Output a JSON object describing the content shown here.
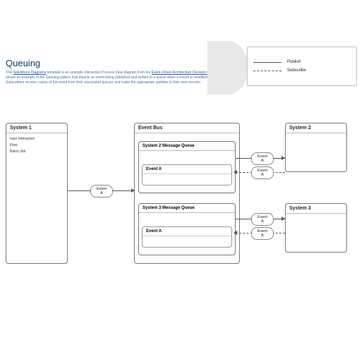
{
  "header": {
    "title": "Queuing",
    "desc_pre": "This ",
    "link1": "Salesforce Diagrams",
    "desc_mid": " template is an example Interaction Process Flow diagram from the ",
    "link2": "Event-Driven Architecture Decision Guide",
    "desc_post": " that shows an example of the Queuing pattern that depicts an event being published and written to a queue when a record is modified. Subscribers receive copies of the event from their associated queues and make the appropriate updates to their own records."
  },
  "legend": {
    "publish": "Publish",
    "subscribe": "Subscribe"
  },
  "system1": {
    "title": "System 1",
    "items": [
      "User Interaction",
      "Flow",
      "Batch Job"
    ]
  },
  "eventBus": {
    "title": "Event Bus"
  },
  "queue2": {
    "title": "System 2 Message Queue",
    "event": "Event A"
  },
  "queue3": {
    "title": "System 3 Message Queue",
    "event": "Event A"
  },
  "system2": {
    "title": "System 2"
  },
  "system3": {
    "title": "System 3"
  },
  "badges": {
    "eventA": "Event\nA"
  }
}
